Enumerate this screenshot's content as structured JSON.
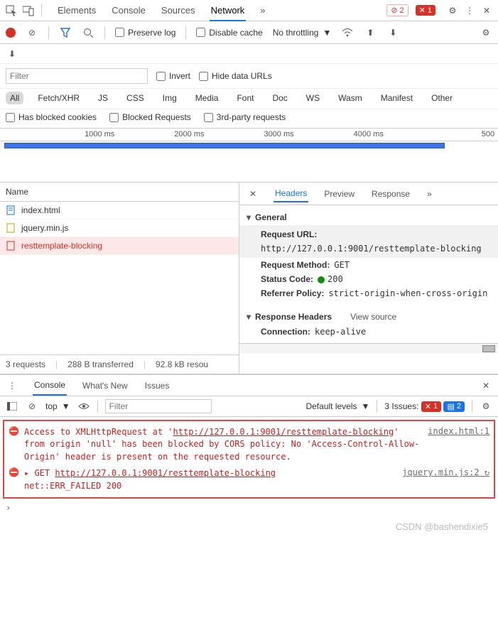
{
  "top_tabs": {
    "items": [
      "Elements",
      "Console",
      "Sources",
      "Network"
    ],
    "active": "Network",
    "more": "»"
  },
  "top_badges": {
    "soft_err": "2",
    "hard_err": "1"
  },
  "toolbar": {
    "preserve_log": "Preserve log",
    "disable_cache": "Disable cache",
    "throttling": "No throttling"
  },
  "filter": {
    "placeholder": "Filter",
    "invert": "Invert",
    "hide_data_urls": "Hide data URLs"
  },
  "types": [
    "All",
    "Fetch/XHR",
    "JS",
    "CSS",
    "Img",
    "Media",
    "Font",
    "Doc",
    "WS",
    "Wasm",
    "Manifest",
    "Other"
  ],
  "types_active": "All",
  "extra_filters": {
    "blocked_cookies": "Has blocked cookies",
    "blocked_requests": "Blocked Requests",
    "third_party": "3rd-party requests"
  },
  "timeline": {
    "ticks": [
      "1000 ms",
      "2000 ms",
      "3000 ms",
      "4000 ms",
      "500"
    ]
  },
  "reqlist": {
    "header": "Name",
    "items": [
      {
        "name": "index.html",
        "icon": "doc"
      },
      {
        "name": "jquery.min.js",
        "icon": "js"
      },
      {
        "name": "resttemplate-blocking",
        "icon": "xhr",
        "selected": true
      }
    ]
  },
  "statusbar": {
    "requests": "3 requests",
    "transferred": "288 B transferred",
    "resources": "92.8 kB resou"
  },
  "details": {
    "tabs": [
      "Headers",
      "Preview",
      "Response"
    ],
    "active": "Headers",
    "more": "»",
    "general_label": "General",
    "request_url_k": "Request URL:",
    "request_url_v": "http://127.0.0.1:9001/resttemplate-blocking",
    "method_k": "Request Method:",
    "method_v": "GET",
    "status_k": "Status Code:",
    "status_v": "200",
    "referrer_k": "Referrer Policy:",
    "referrer_v": "strict-origin-when-cross-origin",
    "resp_hdr": "Response Headers",
    "view_source": "View source",
    "conn_k": "Connection:",
    "conn_v": "keep-alive"
  },
  "drawer_tabs": {
    "items": [
      "Console",
      "What's New",
      "Issues"
    ],
    "active": "Console"
  },
  "console_tb": {
    "context": "top",
    "filter_placeholder": "Filter",
    "levels": "Default levels",
    "issues_label": "3 Issues:",
    "issues_err": "1",
    "issues_warn": "2"
  },
  "console": {
    "msg1_a": "Access to XMLHttpRequest at '",
    "msg1_url": "http://127.0.0.1:9001/resttemplate-blocking",
    "msg1_b": "' from origin 'null' has been blocked by CORS policy: No 'Access-Control-Allow-Origin' header is present on the requested resource.",
    "msg1_src": "index.html:1",
    "msg2_a": "GET ",
    "msg2_url": "http://127.0.0.1:9001/resttemplate-blocking",
    "msg2_b": "net::ERR_FAILED 200",
    "msg2_src": "jquery.min.js:2"
  },
  "watermark": "CSDN @bashendixie5"
}
